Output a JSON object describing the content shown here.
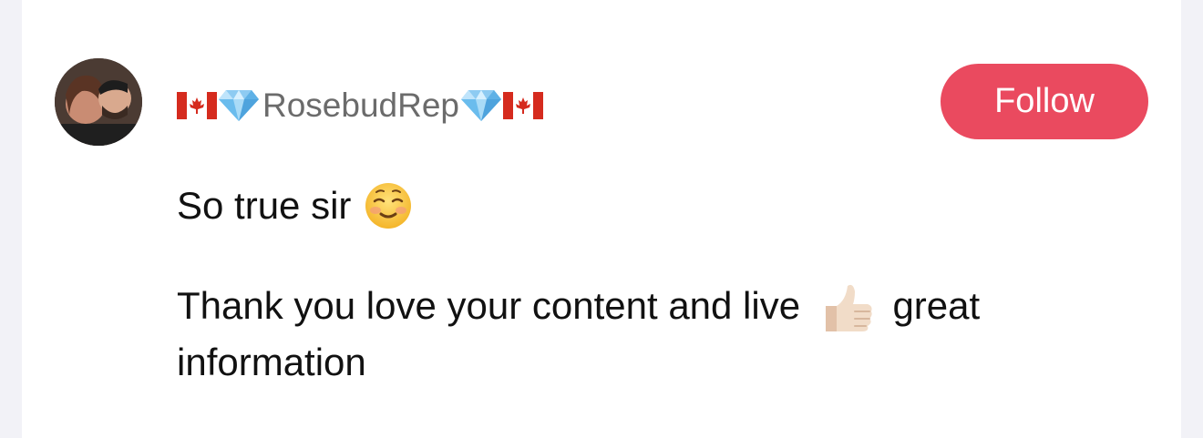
{
  "comment": {
    "username": "RosebudRep",
    "username_decorations": {
      "left": [
        "canadian-flag-icon",
        "gem-icon"
      ],
      "right": [
        "gem-icon",
        "canadian-flag-icon"
      ]
    },
    "follow_label": "Follow",
    "body_line1_text": "So true sir",
    "body_line1_emoji": "smiling-face-icon",
    "body_line2_text_before": "Thank you love your content and live",
    "body_line2_emoji": "thumbs-up-icon",
    "body_line2_text_after": "great",
    "body_line3_text": "information"
  },
  "colors": {
    "follow_button": "#ea4a5f",
    "username": "#6b6b6b",
    "body_text": "#111111",
    "background": "#ffffff",
    "outer_background": "#f2f2f7"
  }
}
